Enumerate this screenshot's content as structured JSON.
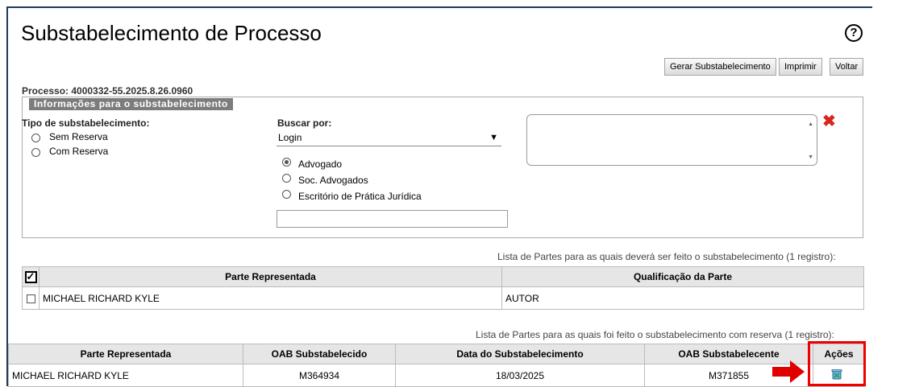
{
  "page": {
    "title": "Substabelecimento de Processo",
    "help_glyph": "?"
  },
  "toolbar": {
    "gerar_label": "Gerar Substabelecimento",
    "imprimir_label": "Imprimir",
    "voltar_label": "Voltar"
  },
  "processo": "Processo: 4000332-55.2025.8.26.0960",
  "form": {
    "legend": "Informações para o substabelecimento",
    "tipo_label": "Tipo de substabelecimento:",
    "tipo_options": [
      "Sem Reserva",
      "Com Reserva"
    ],
    "buscar_label": "Buscar por:",
    "buscar_value": "Login",
    "perfil_options": [
      "Advogado",
      "Soc. Advogados",
      "Escritório de Prática Jurídica"
    ],
    "perfil_selected": "Advogado"
  },
  "table1": {
    "caption": "Lista de Partes para as quais deverá ser feito o substabelecimento (1 registro):",
    "headers": [
      "Parte Representada",
      "Qualificação da Parte"
    ],
    "rows": [
      {
        "parte": "MICHAEL RICHARD KYLE",
        "qualificacao": "AUTOR"
      }
    ]
  },
  "table2": {
    "caption": "Lista de Partes para as quais foi feito o substabelecimento com reserva (1 registro):",
    "headers": [
      "Parte Representada",
      "OAB Substabelecido",
      "Data do Substabelecimento",
      "OAB Substabelecente",
      "Ações"
    ],
    "rows": [
      {
        "parte": "MICHAEL RICHARD KYLE",
        "oab_substabelecido": "M364934",
        "data": "18/03/2025",
        "oab_substabelecente": "M371855"
      }
    ]
  },
  "icons": {
    "remove": "x-icon",
    "delete_row": "trash-icon",
    "pointer": "arrow-right-icon"
  },
  "colors": {
    "highlight": "#e00000",
    "header_bg": "#e6e6e6",
    "legend_bg": "#7c7c7c"
  }
}
